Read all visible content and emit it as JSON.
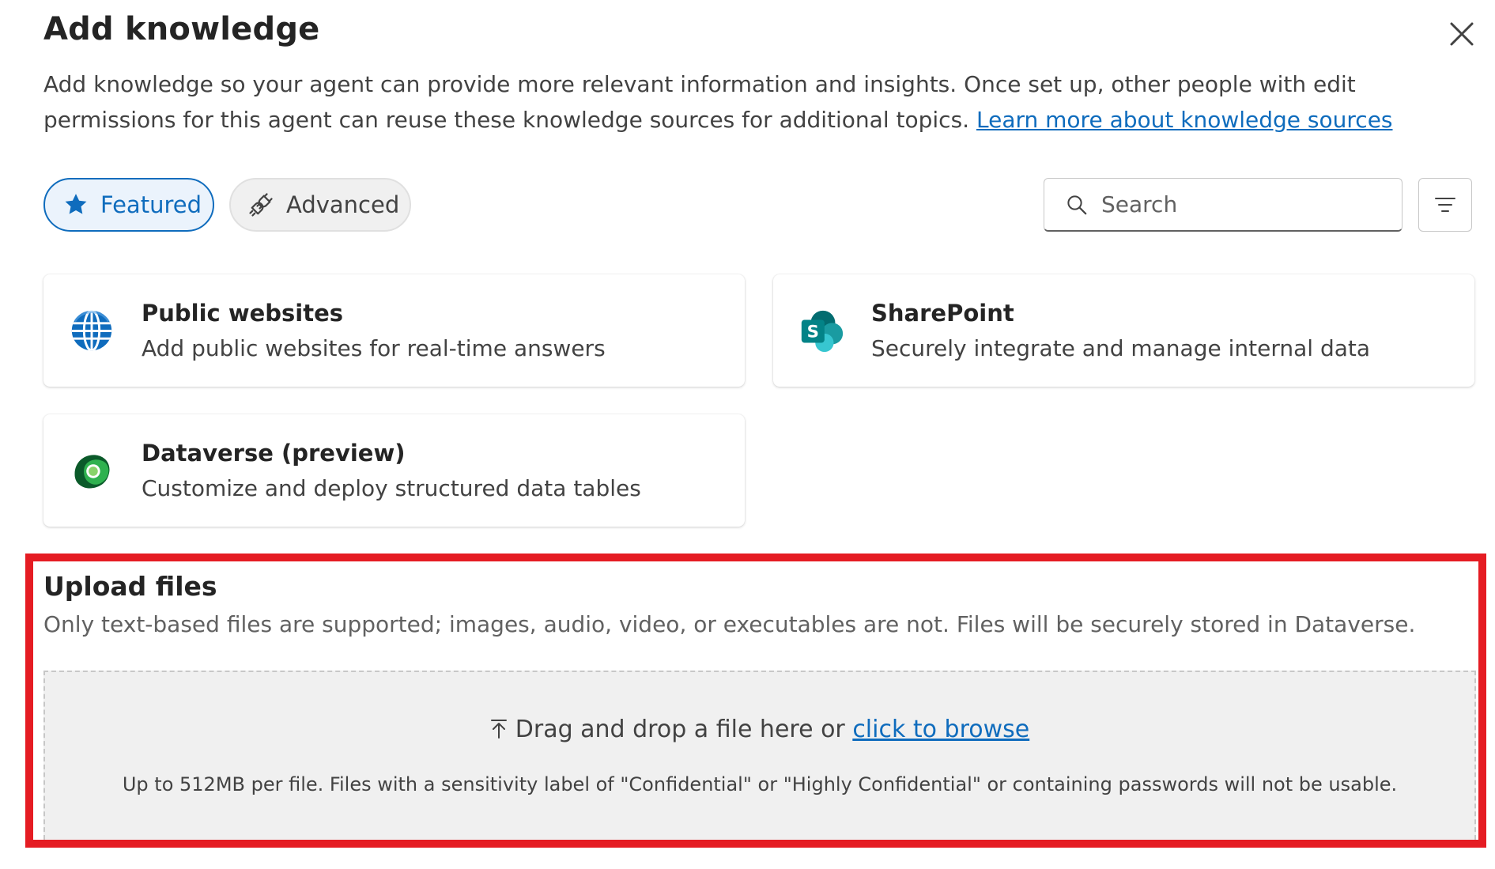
{
  "dialog": {
    "title": "Add knowledge",
    "description": "Add knowledge so your agent can provide more relevant information and insights. Once set up, other people with edit permissions for this agent can reuse these knowledge sources for additional topics.",
    "learn_more_link": "Learn more about knowledge sources",
    "close_icon": "close-icon"
  },
  "tabs": [
    {
      "label": "Featured",
      "icon": "star-icon",
      "selected": true
    },
    {
      "label": "Advanced",
      "icon": "plug-icon",
      "selected": false
    }
  ],
  "search": {
    "placeholder": "Search",
    "value": ""
  },
  "filter_icon": "filter-icon",
  "sources": [
    {
      "title": "Public websites",
      "description": "Add public websites for real-time answers",
      "icon": "globe-icon"
    },
    {
      "title": "SharePoint",
      "description": "Securely integrate and manage internal data",
      "icon": "sharepoint-icon"
    },
    {
      "title": "Dataverse (preview)",
      "description": "Customize and deploy structured data tables",
      "icon": "dataverse-icon"
    }
  ],
  "upload": {
    "title": "Upload files",
    "description": "Only text-based files are supported; images, audio, video, or executables are not. Files will be securely stored in Dataverse.",
    "drop_text": "Drag and drop a file here or",
    "browse_link": "click to browse",
    "note": "Up to 512MB per file. Files with a sensitivity label of \"Confidential\" or \"Highly Confidential\" or containing passwords will not be usable."
  },
  "colors": {
    "accent": "#0f6cbd",
    "highlight_border": "#e51c23"
  }
}
